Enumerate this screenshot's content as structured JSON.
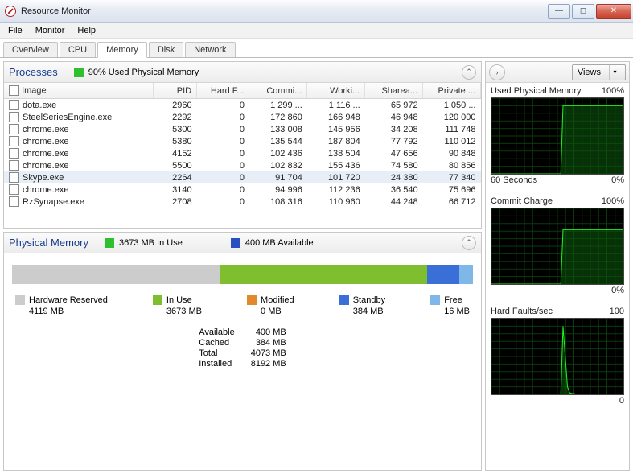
{
  "window": {
    "title": "Resource Monitor"
  },
  "menu": {
    "file": "File",
    "monitor": "Monitor",
    "help": "Help"
  },
  "tabs": {
    "overview": "Overview",
    "cpu": "CPU",
    "memory": "Memory",
    "disk": "Disk",
    "network": "Network"
  },
  "processes": {
    "title": "Processes",
    "usage_text": "90% Used Physical Memory",
    "headers": {
      "image": "Image",
      "pid": "PID",
      "hardf": "Hard F...",
      "commit": "Commi...",
      "working": "Worki...",
      "shareable": "Sharea...",
      "private": "Private ..."
    },
    "rows": [
      {
        "image": "dota.exe",
        "pid": "2960",
        "hardf": "0",
        "commit": "1 299 ...",
        "working": "1 116 ...",
        "shareable": "65 972",
        "private": "1 050 ..."
      },
      {
        "image": "SteelSeriesEngine.exe",
        "pid": "2292",
        "hardf": "0",
        "commit": "172 860",
        "working": "166 948",
        "shareable": "46 948",
        "private": "120 000"
      },
      {
        "image": "chrome.exe",
        "pid": "5300",
        "hardf": "0",
        "commit": "133 008",
        "working": "145 956",
        "shareable": "34 208",
        "private": "111 748"
      },
      {
        "image": "chrome.exe",
        "pid": "5380",
        "hardf": "0",
        "commit": "135 544",
        "working": "187 804",
        "shareable": "77 792",
        "private": "110 012"
      },
      {
        "image": "chrome.exe",
        "pid": "4152",
        "hardf": "0",
        "commit": "102 436",
        "working": "138 504",
        "shareable": "47 656",
        "private": "90 848"
      },
      {
        "image": "chrome.exe",
        "pid": "5500",
        "hardf": "0",
        "commit": "102 832",
        "working": "155 436",
        "shareable": "74 580",
        "private": "80 856"
      },
      {
        "image": "Skype.exe",
        "pid": "2264",
        "hardf": "0",
        "commit": "91 704",
        "working": "101 720",
        "shareable": "24 380",
        "private": "77 340",
        "selected": true
      },
      {
        "image": "chrome.exe",
        "pid": "3140",
        "hardf": "0",
        "commit": "94 996",
        "working": "112 236",
        "shareable": "36 540",
        "private": "75 696"
      },
      {
        "image": "RzSynapse.exe",
        "pid": "2708",
        "hardf": "0",
        "commit": "108 316",
        "working": "110 960",
        "shareable": "44 248",
        "private": "66 712"
      }
    ]
  },
  "physmem": {
    "title": "Physical Memory",
    "inuse_text": "3673 MB In Use",
    "avail_text": "400 MB Available",
    "bar": {
      "hardware_pct": 45,
      "inuse_pct": 45,
      "modified_pct": 0,
      "standby_pct": 7,
      "free_pct": 3
    },
    "legend": {
      "hardware": {
        "label": "Hardware Reserved",
        "value": "4119 MB",
        "color": "#cccccc"
      },
      "inuse": {
        "label": "In Use",
        "value": "3673 MB",
        "color": "#7fbf2f"
      },
      "modified": {
        "label": "Modified",
        "value": "0 MB",
        "color": "#e08a2c"
      },
      "standby": {
        "label": "Standby",
        "value": "384 MB",
        "color": "#3a6fd8"
      },
      "free": {
        "label": "Free",
        "value": "16 MB",
        "color": "#7fb8e8"
      }
    },
    "stats": {
      "available_l": "Available",
      "available_v": "400 MB",
      "cached_l": "Cached",
      "cached_v": "384 MB",
      "total_l": "Total",
      "total_v": "4073 MB",
      "installed_l": "Installed",
      "installed_v": "8192 MB"
    }
  },
  "sidebar": {
    "views_label": "Views",
    "charts": [
      {
        "title": "Used Physical Memory",
        "rightTop": "100%",
        "leftBot": "60 Seconds",
        "rightBot": "0%",
        "level": 90
      },
      {
        "title": "Commit Charge",
        "rightTop": "100%",
        "leftBot": "",
        "rightBot": "0%",
        "level": 72
      },
      {
        "title": "Hard Faults/sec",
        "rightTop": "100",
        "leftBot": "",
        "rightBot": "0",
        "spike": 40
      }
    ]
  },
  "chart_data": [
    {
      "type": "line",
      "title": "Used Physical Memory",
      "ylabel": "%",
      "ylim": [
        0,
        100
      ],
      "xlabel": "60 Seconds",
      "series": [
        {
          "name": "used",
          "values": [
            0,
            0,
            0,
            0,
            0,
            0,
            0,
            0,
            0,
            0,
            0,
            0,
            0,
            0,
            0,
            0,
            0,
            0,
            0,
            0,
            0,
            0,
            0,
            0,
            0,
            0,
            0,
            0,
            0,
            0,
            0,
            0,
            90,
            90,
            90,
            90,
            90,
            90,
            90,
            90,
            90,
            90,
            90,
            90,
            90,
            90,
            90,
            90,
            90,
            90,
            90,
            90,
            90,
            90,
            90,
            90,
            90,
            90,
            90,
            90
          ]
        }
      ]
    },
    {
      "type": "line",
      "title": "Commit Charge",
      "ylabel": "%",
      "ylim": [
        0,
        100
      ],
      "series": [
        {
          "name": "commit",
          "values": [
            0,
            0,
            0,
            0,
            0,
            0,
            0,
            0,
            0,
            0,
            0,
            0,
            0,
            0,
            0,
            0,
            0,
            0,
            0,
            0,
            0,
            0,
            0,
            0,
            0,
            0,
            0,
            0,
            0,
            0,
            0,
            0,
            72,
            72,
            72,
            72,
            72,
            72,
            72,
            72,
            72,
            72,
            72,
            72,
            72,
            72,
            72,
            72,
            72,
            72,
            72,
            72,
            72,
            72,
            72,
            72,
            72,
            72,
            72,
            72
          ]
        }
      ]
    },
    {
      "type": "line",
      "title": "Hard Faults/sec",
      "ylabel": "",
      "ylim": [
        0,
        100
      ],
      "series": [
        {
          "name": "faults",
          "values": [
            0,
            0,
            0,
            0,
            0,
            0,
            0,
            0,
            0,
            0,
            0,
            0,
            0,
            0,
            0,
            0,
            0,
            0,
            0,
            0,
            0,
            0,
            0,
            0,
            0,
            0,
            0,
            0,
            0,
            0,
            0,
            0,
            90,
            50,
            10,
            2,
            1,
            1,
            0,
            0,
            0,
            0,
            0,
            0,
            0,
            0,
            0,
            0,
            0,
            0,
            0,
            0,
            0,
            0,
            0,
            0,
            0,
            0,
            0,
            0
          ]
        }
      ]
    }
  ]
}
